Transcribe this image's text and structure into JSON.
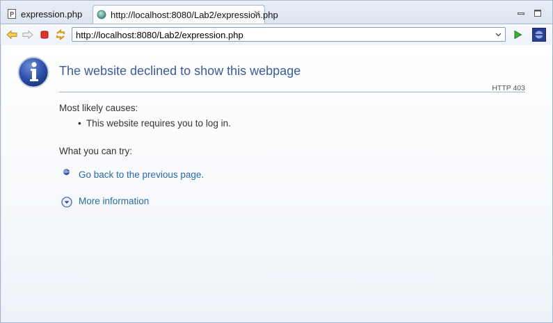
{
  "tabs": [
    {
      "label": "expression.php",
      "icon": "php-file-icon",
      "active": false
    },
    {
      "label": "http://localhost:8080/Lab2/expression.php",
      "icon": "globe-icon",
      "active": true
    }
  ],
  "toolbar": {
    "url": "http://localhost:8080/Lab2/expression.php",
    "buttons": [
      "back-arrow-icon",
      "forward-arrow-icon",
      "stop-icon",
      "refresh-icon",
      "go-icon",
      "eclipse-icon"
    ]
  },
  "error_page": {
    "title": "The website declined to show this webpage",
    "code": "HTTP 403",
    "causes_heading": "Most likely causes:",
    "causes": [
      "This website requires you to log in."
    ],
    "try_heading": "What you can try:",
    "back_link": "Go back to the previous page.",
    "more_info": "More information"
  },
  "colors": {
    "title": "#3b5b9a",
    "link": "#2a6aa5",
    "frame_border": "#a9b8cc"
  }
}
